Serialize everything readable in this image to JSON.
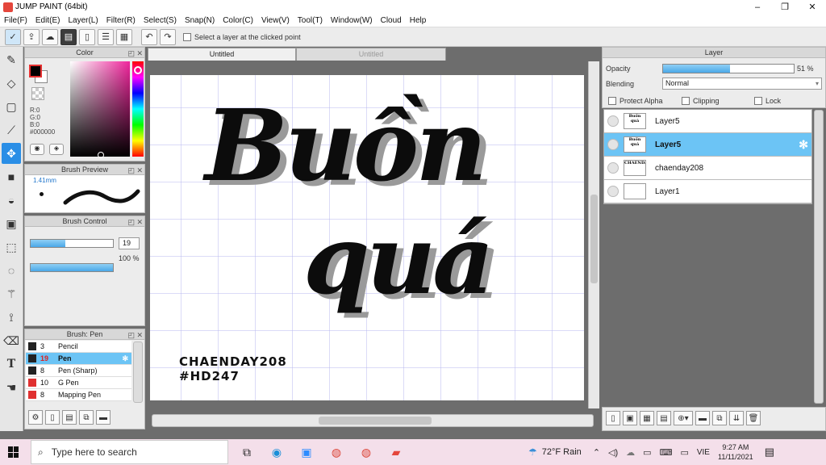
{
  "window": {
    "title": "JUMP PAINT (64bit)",
    "controls": [
      "–",
      "❐",
      "✕"
    ]
  },
  "menu": [
    "File(F)",
    "Edit(E)",
    "Layer(L)",
    "Filter(R)",
    "Select(S)",
    "Snap(N)",
    "Color(C)",
    "View(V)",
    "Tool(T)",
    "Window(W)",
    "Cloud",
    "Help"
  ],
  "toolbar": {
    "select_layer_label": "Select a layer at the clicked point"
  },
  "color_panel": {
    "title": "Color",
    "r": "R:0",
    "g": "G:0",
    "b": "B:0",
    "hex": "#000000",
    "fg": "#000000",
    "bg": "#ffffff"
  },
  "brush_preview": {
    "title": "Brush Preview",
    "size": "1.41mm"
  },
  "brush_control": {
    "title": "Brush Control",
    "size_value": "19",
    "size_fill": 0.42,
    "opacity_value": "100 %",
    "opacity_fill": 1.0
  },
  "brush_list": {
    "title": "Brush: Pen",
    "items": [
      {
        "size": "3",
        "name": "Pencil",
        "color": "#222222",
        "selected": false
      },
      {
        "size": "19",
        "name": "Pen",
        "color": "#222222",
        "selected": true
      },
      {
        "size": "8",
        "name": "Pen (Sharp)",
        "color": "#222222",
        "selected": false
      },
      {
        "size": "10",
        "name": "G Pen",
        "color": "#e03030",
        "selected": false
      },
      {
        "size": "8",
        "name": "Mapping Pen",
        "color": "#e03030",
        "selected": false
      }
    ]
  },
  "tabs": [
    {
      "label": "Untitled",
      "active": true
    },
    {
      "label": "Untitled",
      "active": false
    }
  ],
  "canvas": {
    "line1": "Buồn",
    "line2": "quá",
    "sig1": "CHAENDAY208",
    "sig2": "#HD247"
  },
  "layer_panel": {
    "title": "Layer",
    "opacity_label": "Opacity",
    "opacity_value": "51 %",
    "opacity_fill": 0.51,
    "blending_label": "Blending",
    "blending_value": "Normal",
    "protect_alpha": "Protect Alpha",
    "clipping": "Clipping",
    "lock": "Lock",
    "layers": [
      {
        "name": "Layer5",
        "selected": false,
        "thumb": "Buồn quá"
      },
      {
        "name": "Layer5",
        "selected": true,
        "thumb": "Buồn quá"
      },
      {
        "name": "chaenday208",
        "selected": false,
        "thumb": "CHAENDAY208"
      },
      {
        "name": "Layer1",
        "selected": false,
        "thumb": ""
      }
    ]
  },
  "taskbar": {
    "search_placeholder": "Type here to search",
    "weather": "72°F  Rain",
    "lang": "VIE",
    "time": "9:27 AM",
    "date": "11/11/2021"
  }
}
